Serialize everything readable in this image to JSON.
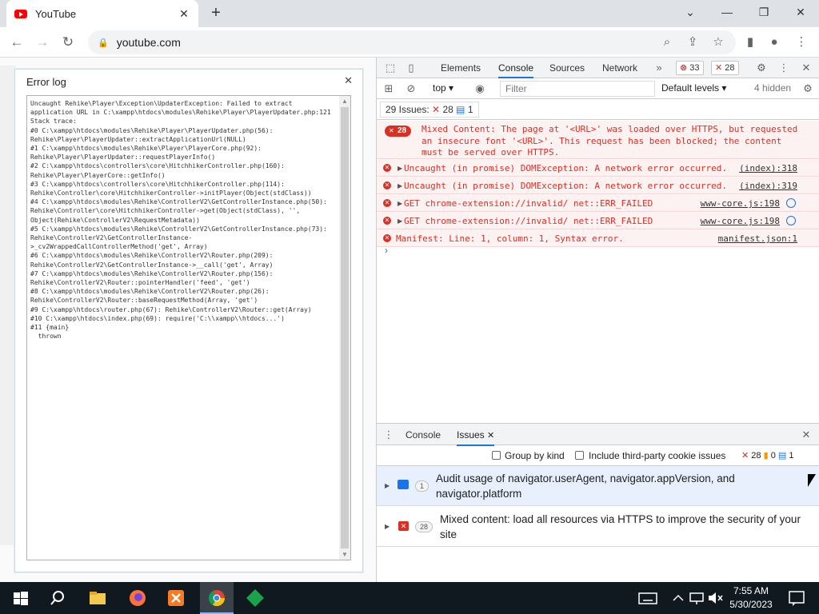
{
  "browser": {
    "tab_title": "YouTube",
    "url": "youtube.com"
  },
  "error_log": {
    "title": "Error log",
    "lines": [
      "Uncaught Rehike\\Player\\Exception\\UpdaterException: Failed to extract",
      "application URL in C:\\xampp\\htdocs\\modules\\Rehike\\Player\\PlayerUpdater.php:121",
      "Stack trace:",
      "#0 C:\\xampp\\htdocs\\modules\\Rehike\\Player\\PlayerUpdater.php(56):",
      "Rehike\\Player\\PlayerUpdater::extractApplicationUrl(NULL)",
      "#1 C:\\xampp\\htdocs\\modules\\Rehike\\Player\\PlayerCore.php(92):",
      "Rehike\\Player\\PlayerUpdater::requestPlayerInfo()",
      "#2 C:\\xampp\\htdocs\\controllers\\core\\HitchhikerController.php(160):",
      "Rehike\\Player\\PlayerCore::getInfo()",
      "#3 C:\\xampp\\htdocs\\controllers\\core\\HitchhikerController.php(114):",
      "Rehike\\Controller\\core\\HitchhikerController->initPlayer(Object(stdClass))",
      "#4 C:\\xampp\\htdocs\\modules\\Rehike\\ControllerV2\\GetControllerInstance.php(50):",
      "Rehike\\Controller\\core\\HitchhikerController->get(Object(stdClass), '',",
      "Object(Rehike\\ControllerV2\\RequestMetadata))",
      "#5 C:\\xampp\\htdocs\\modules\\Rehike\\ControllerV2\\GetControllerInstance.php(73):",
      "Rehike\\ControllerV2\\GetControllerInstance-",
      ">_cv2WrappedCallControllerMethod('get', Array)",
      "#6 C:\\xampp\\htdocs\\modules\\Rehike\\ControllerV2\\Router.php(209):",
      "Rehike\\ControllerV2\\GetControllerInstance->__call('get', Array)",
      "#7 C:\\xampp\\htdocs\\modules\\Rehike\\ControllerV2\\Router.php(156):",
      "Rehike\\ControllerV2\\Router::pointerHandler('feed', 'get')",
      "#8 C:\\xampp\\htdocs\\modules\\Rehike\\ControllerV2\\Router.php(26):",
      "Rehike\\ControllerV2\\Router::baseRequestMethod(Array, 'get')",
      "#9 C:\\xampp\\htdocs\\router.php(67): Rehike\\ControllerV2\\Router::get(Array)",
      "#10 C:\\xampp\\htdocs\\index.php(69): require('C:\\\\xampp\\\\htdocs...')",
      "#11 {main}",
      "  thrown"
    ]
  },
  "devtools": {
    "tabs": [
      "Elements",
      "Console",
      "Sources",
      "Network"
    ],
    "active_tab": "Console",
    "error_count": "33",
    "issue_count": "28",
    "context": "top",
    "filter_placeholder": "Filter",
    "levels": "Default levels",
    "hidden": "4 hidden",
    "issues_summary": {
      "label": "29 Issues:",
      "errors": "28",
      "info": "1"
    },
    "messages": [
      {
        "type": "mixed",
        "count": "28",
        "text": "Mixed Content: The page at '<URL>' was loaded over HTTPS, but requested\nan insecure font '<URL>'. This request has been blocked; the content\nmust be served over HTTPS.",
        "source": ""
      },
      {
        "type": "error",
        "text": "Uncaught (in promise) DOMException: A network error occurred.",
        "source": "(index):318"
      },
      {
        "type": "error",
        "text": "Uncaught (in promise) DOMException: A network error occurred.",
        "source": "(index):319"
      },
      {
        "type": "error",
        "text": "GET chrome-extension://invalid/ net::ERR_FAILED",
        "source": "www-core.js:198"
      },
      {
        "type": "error",
        "text": "GET chrome-extension://invalid/ net::ERR_FAILED",
        "source": "www-core.js:198"
      },
      {
        "type": "error",
        "text": "Manifest: Line: 1, column: 1, Syntax error.",
        "source": "manifest.json:1"
      }
    ],
    "drawer": {
      "tabs": [
        "Console",
        "Issues"
      ],
      "active_tab": "Issues",
      "group_by_kind": "Group by kind",
      "third_party": "Include third-party cookie issues",
      "counts": {
        "errors": "28",
        "warnings": "0",
        "info": "1"
      },
      "issues": [
        {
          "count": "1",
          "kind": "info",
          "text": "Audit usage of navigator.userAgent, navigator.appVersion, and navigator.platform"
        },
        {
          "count": "28",
          "kind": "error",
          "text": "Mixed content: load all resources via HTTPS to improve the security of your site"
        }
      ]
    }
  },
  "taskbar": {
    "time": "7:55 AM",
    "date": "5/30/2023"
  },
  "colors": {
    "error_red": "#d93025",
    "accent_blue": "#1a73e8",
    "youtube_red": "#ff0000",
    "taskbar_bg": "#101820"
  }
}
